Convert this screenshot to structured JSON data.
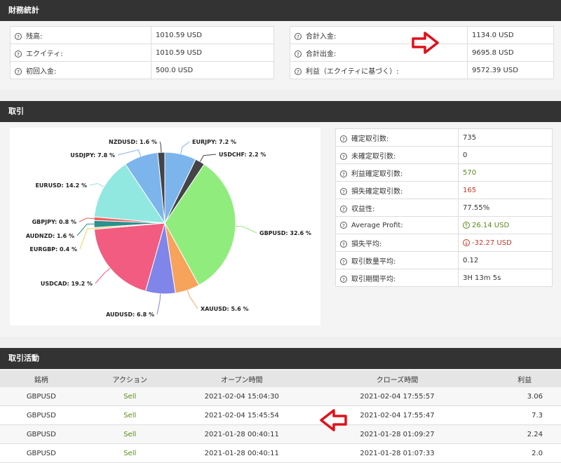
{
  "finance": {
    "title": "財務統計",
    "left": [
      {
        "label": "残高:",
        "value": "1010.59 USD"
      },
      {
        "label": "エクイティ:",
        "value": "1010.59 USD"
      },
      {
        "label": "初回入金:",
        "value": "500.0 USD"
      }
    ],
    "right": [
      {
        "label": "合計入金:",
        "value": "1134.0 USD"
      },
      {
        "label": "合計出金:",
        "value": "9695.8 USD"
      },
      {
        "label": "利益（エクイティに基づく）:",
        "value": "9572.39 USD"
      }
    ]
  },
  "trading": {
    "title": "取引",
    "stats": [
      {
        "label": "確定取引数:",
        "value": "735",
        "color": ""
      },
      {
        "label": "未確定取引数:",
        "value": "0",
        "color": ""
      },
      {
        "label": "利益確定取引数:",
        "value": "570",
        "color": "green"
      },
      {
        "label": "損失確定取引数:",
        "value": "165",
        "color": "red"
      },
      {
        "label": "収益性:",
        "value": "77.55%",
        "color": ""
      },
      {
        "label": "Average Profit:",
        "value": "26.14 USD",
        "color": "green",
        "icon": "up"
      },
      {
        "label": "損失平均:",
        "value": "-32.27 USD",
        "color": "red",
        "icon": "down"
      },
      {
        "label": "取引数量平均:",
        "value": "0.12",
        "color": ""
      },
      {
        "label": "取引期間平均:",
        "value": "3H 13m 5s",
        "color": ""
      }
    ]
  },
  "chart_data": {
    "type": "pie",
    "slices": [
      {
        "label": "EURJPY: 7.2 %",
        "value": 7.2,
        "color": "#7cb5ec"
      },
      {
        "label": "USDCHF: 2.2 %",
        "value": 2.2,
        "color": "#434348"
      },
      {
        "label": "GBPUSD: 32.6 %",
        "value": 32.6,
        "color": "#90ed7d"
      },
      {
        "label": "XAUUSD: 5.6 %",
        "value": 5.6,
        "color": "#f7a35c"
      },
      {
        "label": "AUDUSD: 6.8 %",
        "value": 6.8,
        "color": "#8085e9"
      },
      {
        "label": "USDCAD: 19.2 %",
        "value": 19.2,
        "color": "#f15c80"
      },
      {
        "label": "EURGBP: 0.4 %",
        "value": 0.4,
        "color": "#e4d354"
      },
      {
        "label": "AUDNZD: 1.6 %",
        "value": 1.6,
        "color": "#2b908f"
      },
      {
        "label": "GBPJPY: 0.8 %",
        "value": 0.8,
        "color": "#f45b5b"
      },
      {
        "label": "EURUSD: 14.2 %",
        "value": 14.2,
        "color": "#91e8e1"
      },
      {
        "label": "USDJPY: 7.8 %",
        "value": 7.8,
        "color": "#7cb5ec"
      },
      {
        "label": "NZDUSD: 1.6 %",
        "value": 1.6,
        "color": "#434348"
      }
    ]
  },
  "activity": {
    "title": "取引活動",
    "columns": [
      "銘柄",
      "アクション",
      "オープン時間",
      "クローズ時間",
      "利益"
    ],
    "rows": [
      [
        "GBPUSD",
        "Sell",
        "2021-02-04 15:04:30",
        "2021-02-04 17:55:57",
        "3.06"
      ],
      [
        "GBPUSD",
        "Sell",
        "2021-02-04 15:45:54",
        "2021-02-04 17:55:47",
        "7.3"
      ],
      [
        "GBPUSD",
        "Sell",
        "2021-01-28 00:40:11",
        "2021-01-28 01:09:27",
        "2.24"
      ],
      [
        "GBPUSD",
        "Sell",
        "2021-01-28 00:40:11",
        "2021-01-28 01:07:33",
        "2.0"
      ]
    ]
  },
  "colors": {
    "arrow": "#e0101a",
    "header": "#333333",
    "sell": "#5a8a1a"
  }
}
